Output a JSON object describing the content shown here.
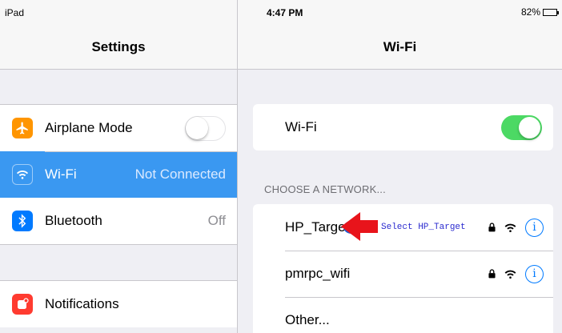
{
  "status_bar": {
    "device": "iPad",
    "time": "4:47 PM",
    "battery": "82%"
  },
  "master": {
    "title": "Settings",
    "group1": [
      {
        "label": "Airplane Mode",
        "icon": "airplane-icon",
        "icon_color": "#ff9500",
        "toggle": "off"
      },
      {
        "label": "Wi-Fi",
        "icon": "wifi-icon",
        "icon_color": "#3a98f1",
        "value": "Not Connected",
        "selected": true
      },
      {
        "label": "Bluetooth",
        "icon": "bluetooth-icon",
        "icon_color": "#007aff",
        "value": "Off"
      }
    ],
    "group2": [
      {
        "label": "Notifications",
        "icon": "notifications-icon",
        "icon_color": "#ff3b30"
      }
    ]
  },
  "detail": {
    "title": "Wi-Fi",
    "wifi_toggle_label": "Wi-Fi",
    "wifi_toggle_state": "on",
    "section_header": "CHOOSE A NETWORK...",
    "networks": [
      {
        "name": "HP_Target",
        "locked": true
      },
      {
        "name": "pmrpc_wifi",
        "locked": true
      },
      {
        "name": "Other..."
      }
    ]
  },
  "annotation": {
    "text": "Select HP_Target",
    "arrow_color": "#e8141b"
  },
  "colors": {
    "selected_row": "#3a98f1",
    "toggle_on": "#4cd964",
    "link_blue": "#007aff"
  }
}
